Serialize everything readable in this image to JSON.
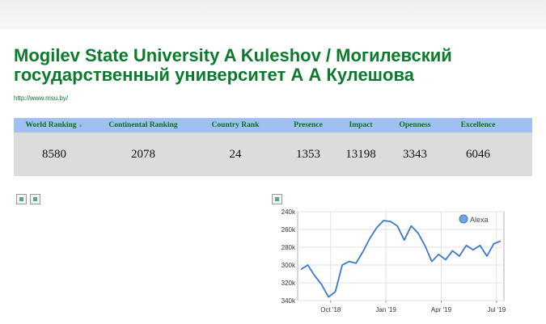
{
  "header": {
    "title": "Mogilev State University A Kuleshov / Могилевский государственный университет А А Кулешова",
    "url": "http://www.msu.by/"
  },
  "ranking_table": {
    "columns": [
      "World Ranking",
      "Continental Ranking",
      "Country Rank",
      "Presence",
      "Impact",
      "Openness",
      "Excellence"
    ],
    "values": [
      "8580",
      "2078",
      "24",
      "1353",
      "13198",
      "3343",
      "6046"
    ],
    "sort_icon": "sort-arrow-icon"
  },
  "images": {
    "broken_left": [
      "broken-image-icon",
      "broken-image-icon"
    ],
    "broken_chart": "broken-image-icon"
  },
  "chart_data": {
    "type": "line",
    "title": "",
    "legend": "Alexa",
    "legend_placement": "top-right",
    "y_inverted": true,
    "ylim": [
      240,
      340
    ],
    "y_ticks": [
      "240k",
      "260k",
      "280k",
      "300k",
      "320k",
      "340k"
    ],
    "x_ticks": [
      "Oct '18",
      "Jan '19",
      "Apr '19",
      "Jul '19"
    ],
    "x": [
      "Aug '18",
      "Aug '18",
      "Sep '18",
      "Sep '18",
      "Sep '18",
      "Oct '18",
      "Oct '18",
      "Oct '18",
      "Nov '18",
      "Nov '18",
      "Dec '18",
      "Dec '18",
      "Dec '18",
      "Jan '19",
      "Jan '19",
      "Jan '19",
      "Feb '19",
      "Feb '19",
      "Mar '19",
      "Mar '19",
      "Apr '19",
      "Apr '19",
      "May '19",
      "May '19",
      "May '19",
      "Jun '19",
      "Jun '19",
      "Jul '19",
      "Jul '19",
      "Jul '19"
    ],
    "values": [
      305,
      300,
      312,
      322,
      336,
      330,
      300,
      296,
      298,
      285,
      270,
      258,
      250,
      251,
      256,
      272,
      256,
      264,
      278,
      296,
      288,
      294,
      284,
      290,
      278,
      283,
      278,
      290,
      276,
      273
    ],
    "series_color": "#3d79c9",
    "grid": true
  }
}
